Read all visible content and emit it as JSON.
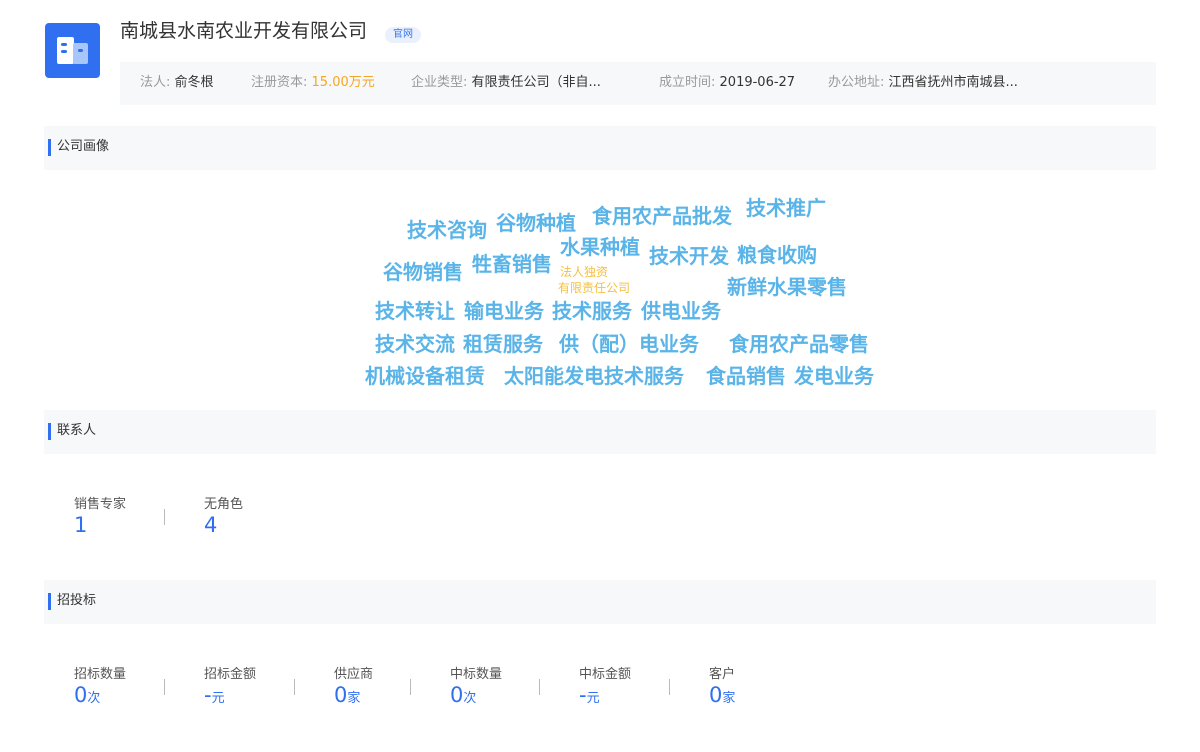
{
  "company": {
    "name": "南城县水南农业开发有限公司",
    "official_tag": "官网"
  },
  "info": {
    "legal_label": "法人:",
    "legal_value": "俞冬根",
    "capital_label": "注册资本:",
    "capital_value": "15.00万元",
    "type_label": "企业类型:",
    "type_value": "有限责任公司（非自...",
    "date_label": "成立时间:",
    "date_value": "2019-06-27",
    "address_label": "办公地址:",
    "address_value": "江西省抚州市南城县..."
  },
  "sections": {
    "portrait": "公司画像",
    "contacts": "联系人",
    "bidding": "招投标"
  },
  "word_cloud": [
    "技术咨询",
    "谷物种植",
    "食用农产品批发",
    "技术推广",
    "谷物销售",
    "牲畜销售",
    "水果种植",
    "技术开发",
    "粮食收购",
    "法人独资",
    "有限责任公司",
    "新鲜水果零售",
    "技术转让",
    "输电业务",
    "技术服务",
    "供电业务",
    "技术交流",
    "租赁服务",
    "供（配）电业务",
    "食用农产品零售",
    "机械设备租赁",
    "太阳能发电技术服务",
    "食品销售",
    "发电业务"
  ],
  "contacts": [
    {
      "label": "销售专家",
      "value": "1"
    },
    {
      "label": "无角色",
      "value": "4"
    }
  ],
  "bidding": [
    {
      "label": "招标数量",
      "value": "0",
      "unit": "次"
    },
    {
      "label": "招标金额",
      "value": "-",
      "unit": "元"
    },
    {
      "label": "供应商",
      "value": "0",
      "unit": "家"
    },
    {
      "label": "中标数量",
      "value": "0",
      "unit": "次"
    },
    {
      "label": "中标金额",
      "value": "-",
      "unit": "元"
    },
    {
      "label": "客户",
      "value": "0",
      "unit": "家"
    }
  ],
  "colors": {
    "accent": "#2f6ff0",
    "cloud_blue": "#5ab4e8",
    "cloud_yellow": "#f5c042",
    "capital_orange": "#f5a623"
  }
}
